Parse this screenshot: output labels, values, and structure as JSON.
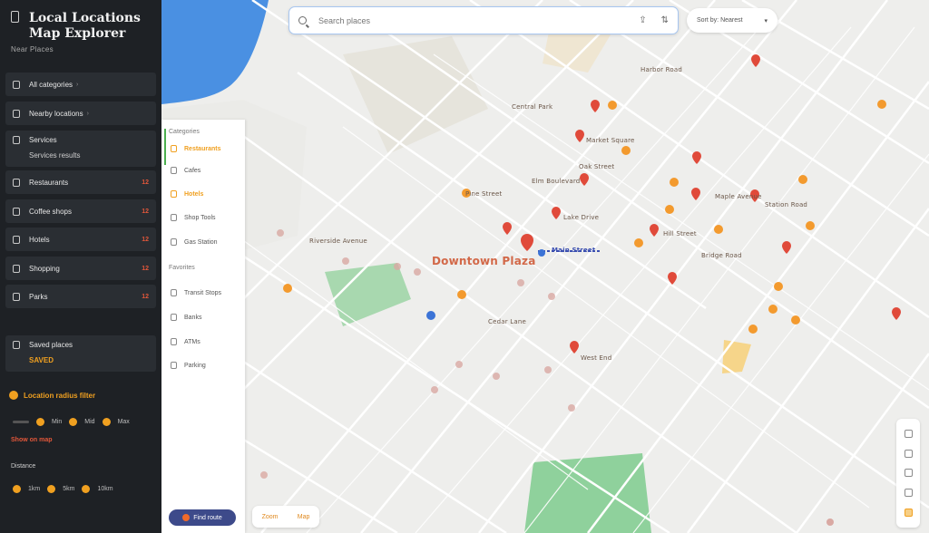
{
  "sidebar": {
    "title_line1": "Local Locations",
    "title_line2": "Map Explorer",
    "subtitle": "Near Places",
    "rows": [
      {
        "label": "All categories",
        "tag": ""
      },
      {
        "label": "Nearby locations",
        "tag": ""
      },
      {
        "label": "Restaurants",
        "tag": "12"
      },
      {
        "label": "Coffee shops",
        "tag": "12"
      },
      {
        "label": "Hotels",
        "tag": "12"
      },
      {
        "label": "Shopping",
        "tag": "12"
      },
      {
        "label": "Parks",
        "tag": "12"
      }
    ],
    "row2a": {
      "label": "Services",
      "line2": "Services results"
    },
    "row2b": {
      "label": "Saved places",
      "line2": "SAVED"
    },
    "amber_heading": "Location radius filter",
    "slider_labels": [
      "Min",
      "Mid",
      "Max"
    ],
    "line_a": "Show on map",
    "line_b": "Distance",
    "slider2_labels": [
      "1km",
      "5km",
      "10km"
    ]
  },
  "search": {
    "placeholder": "Search places",
    "value": ""
  },
  "filter": {
    "label": "Sort by: Nearest"
  },
  "layers": {
    "heading1": "Categories",
    "items1": [
      {
        "label": "Restaurants",
        "active": true
      },
      {
        "label": "Cafes",
        "active": false
      },
      {
        "label": "Hotels",
        "active": true
      },
      {
        "label": "Shop Tools",
        "active": false
      },
      {
        "label": "Gas Station",
        "active": false
      }
    ],
    "heading2": "Favorites",
    "items2": [
      {
        "label": "Transit Stops"
      },
      {
        "label": "Banks"
      },
      {
        "label": "ATMs"
      },
      {
        "label": "Parking"
      }
    ],
    "pill": "Find route"
  },
  "bottom_chip": {
    "a": "Zoom",
    "b": "Map"
  },
  "map_labels": {
    "center": "Downtown Plaza",
    "blue": "Main Street",
    "l1": "Riverside Avenue",
    "l2": "Harbor Road",
    "l3": "Central Park",
    "l4": "Market Square",
    "l5": "Oak Street",
    "l6": "Elm Boulevard",
    "l7": "Pine Street",
    "l8": "Maple Avenue",
    "l9": "Station Road",
    "l10": "Lake Drive",
    "l11": "Hill Street",
    "l12": "Bridge Road",
    "l13": "Cedar Lane",
    "l14": "West End"
  },
  "colors": {
    "sidebar_bg": "#1e2125",
    "accent_orange": "#f0a020",
    "pin_red": "#e04a3a",
    "pin_orange": "#f39a2e",
    "water": "#4a90e2",
    "park": "#9bd4a4"
  }
}
